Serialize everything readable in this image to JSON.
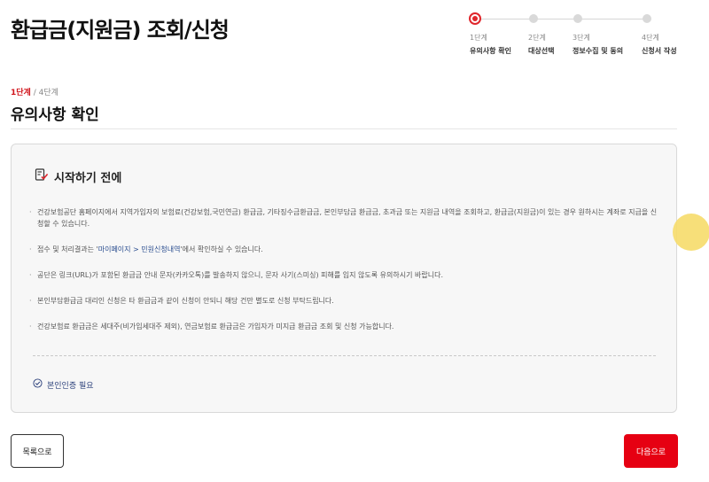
{
  "page": {
    "title": "환급금(지원금) 조회/신청"
  },
  "stepper": {
    "steps": [
      {
        "num": "1단계",
        "label": "유의사항 확인"
      },
      {
        "num": "2단계",
        "label": "대상선택"
      },
      {
        "num": "3단계",
        "label": "정보수집 및 동의"
      },
      {
        "num": "4단계",
        "label": "신청서 작성"
      }
    ],
    "active_index": 0,
    "active_color": "#e0262c"
  },
  "current_step": {
    "current": "1단계",
    "separator": " / ",
    "total": "4단계"
  },
  "section": {
    "title": "유의사항 확인"
  },
  "info_box": {
    "icon": "checklist-icon",
    "title": "시작하기 전에",
    "notes": [
      {
        "text": "건강보험공단 홈페이지에서 지역가입자의 보험료(건강보험,국민연금) 환급금, 기타징수금환급금, 본인부담금 환급금, 초과금 또는 지원금 내역을 조회하고, 환급금(지원금)이 있는 경우 원하시는 계좌로 지급을 신청할 수 있습니다."
      },
      {
        "pre": "접수 및 처리결과는 '",
        "link": "마이페이지 > 민원신청내역",
        "post": "'에서 확인하실 수 있습니다."
      },
      {
        "text": "공단은 링크(URL)가 포함된 환급금 안내 문자(카카오톡)를 발송하지 않으니, 문자 사기(스미싱) 피해를 입지 않도록 유의하시기 바랍니다."
      },
      {
        "text": "본인부담환급금 대리인 신청은 타 환급금과 같이 신청이 안되니 해당 건만 별도로 신청 부탁드립니다."
      },
      {
        "text": "건강보험료 환급금은 세대주(비가입세대주 제외), 연금보험료 환급금은 가입자가 미지급 환급금 조회 및 신청 가능합니다."
      }
    ],
    "auth_icon": "check-circle-icon",
    "auth_label": "본인인증 필요"
  },
  "buttons": {
    "list": "목록으로",
    "next": "다음으로",
    "next_color": "#e60012"
  }
}
